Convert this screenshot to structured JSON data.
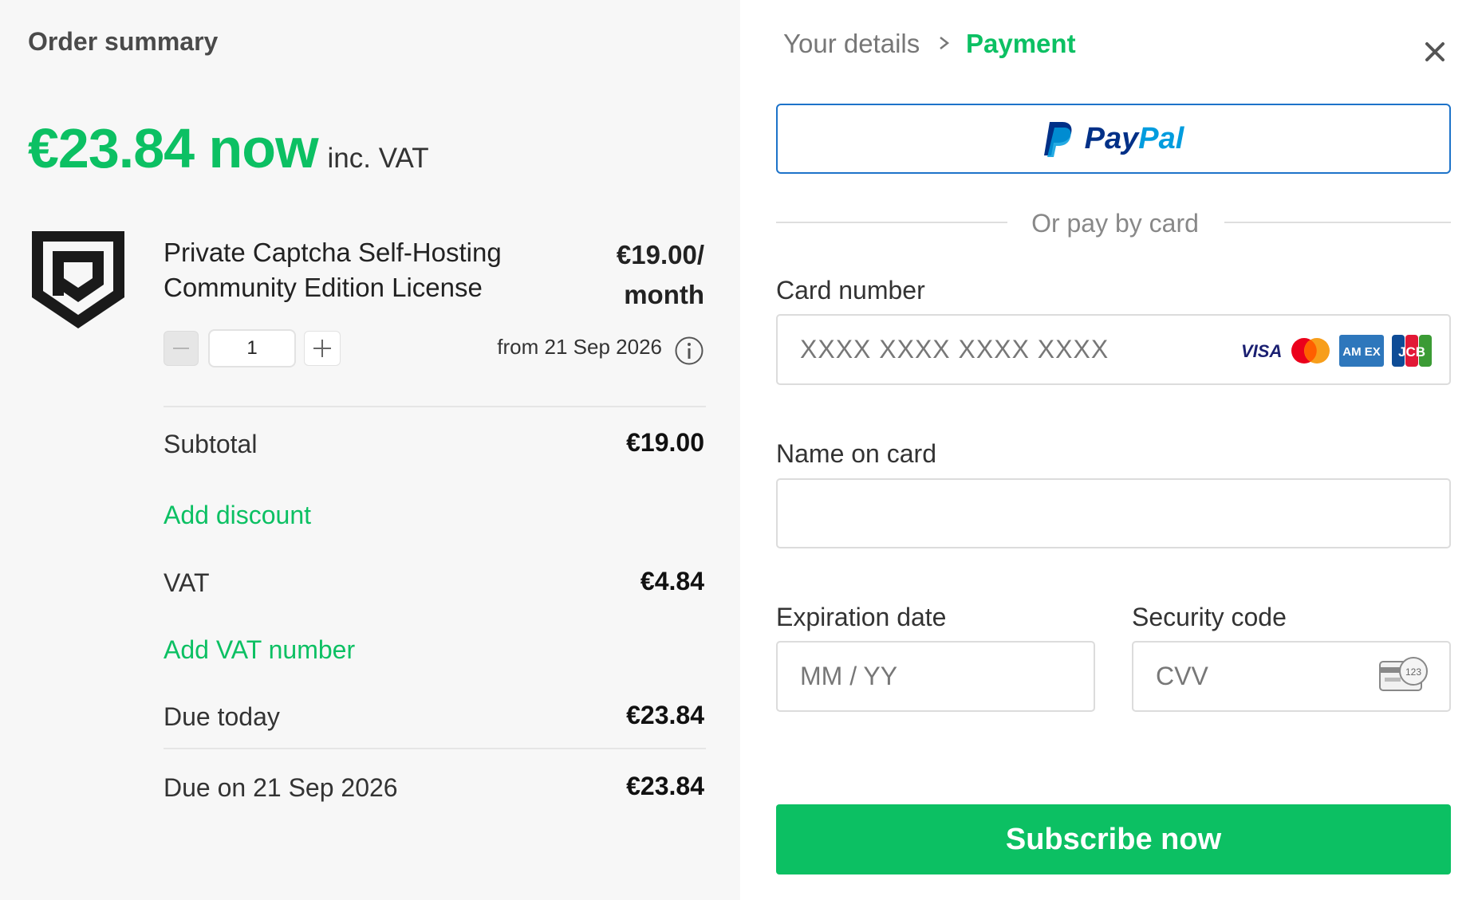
{
  "order_summary": {
    "title": "Order summary",
    "price_now": "€23.84 now",
    "price_note": "inc. VAT",
    "product": {
      "name_line1": "Private Captcha Self-Hosting",
      "name_line2": "Community Edition License",
      "price_line1": "€19.00/",
      "price_line2": "month",
      "quantity": "1",
      "start_text": "from 21 Sep 2026",
      "logo_icon": "shield-logo-icon",
      "minus_icon": "minus-icon",
      "plus_icon": "plus-icon",
      "info_icon": "info-icon"
    },
    "subtotal_label": "Subtotal",
    "subtotal_value": "€19.00",
    "add_discount": "Add discount",
    "vat_label": "VAT",
    "vat_value": "€4.84",
    "add_vat_number": "Add VAT number",
    "due_today_label": "Due today",
    "due_today_value": "€23.84",
    "due_later_label": "Due on 21 Sep 2026",
    "due_later_value": "€23.84"
  },
  "payment": {
    "breadcrumb": {
      "step1": "Your details",
      "separator_icon": "chevron-right-icon",
      "step2": "Payment"
    },
    "close_icon": "close-icon",
    "paypal": {
      "pay": "Pay",
      "pal": "Pal",
      "icon": "paypal-icon"
    },
    "or_text": "Or pay by card",
    "card_number": {
      "label": "Card number",
      "placeholder": "XXXX XXXX XXXX XXXX",
      "logos": [
        "visa-icon",
        "mastercard-icon",
        "amex-icon",
        "jcb-icon"
      ],
      "visa_text": "VISA",
      "amex_text": "AM EX",
      "jcb_text": "JCB"
    },
    "name_on_card": {
      "label": "Name on card",
      "value": ""
    },
    "expiration": {
      "label": "Expiration date",
      "placeholder": "MM / YY"
    },
    "security": {
      "label": "Security code",
      "placeholder": "CVV",
      "icon": "cvv-card-icon",
      "icon_text": "123"
    },
    "subscribe_label": "Subscribe now"
  },
  "colors": {
    "accent": "#0cc063",
    "paypal_border": "#1d73c9",
    "paypal_dark": "#003087",
    "paypal_light": "#009cde",
    "left_bg": "#f7f7f7"
  }
}
